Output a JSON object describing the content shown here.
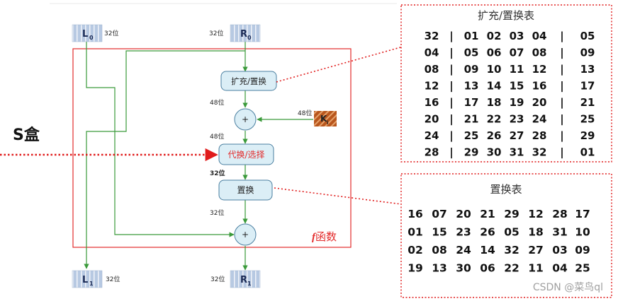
{
  "diagram": {
    "s_box_label": "S盒",
    "inputs": {
      "L0": {
        "main": "L",
        "sub": "0",
        "bits": "32位"
      },
      "R0": {
        "main": "R",
        "sub": "0",
        "bits": "32位"
      }
    },
    "outputs": {
      "L1": {
        "main": "L",
        "sub": "1",
        "bits": "32位"
      },
      "R1": {
        "main": "R",
        "sub": "1",
        "bits": "32位"
      }
    },
    "key": {
      "main": "K",
      "sub": "i",
      "bits": "48位"
    },
    "blocks": {
      "expand": "扩充/置换",
      "substitute": "代换/选择",
      "permute": "置换",
      "xor_symbol": "+"
    },
    "bit_labels": {
      "after_expand": "48位",
      "after_xor": "48位",
      "after_sbox": "32位",
      "after_perm": "32位"
    },
    "f_label": {
      "f": "f",
      "rest": "函数"
    }
  },
  "expansion_table": {
    "title": "扩充/置换表",
    "rows": [
      [
        "32",
        "|",
        "01",
        "02",
        "03",
        "04",
        "|",
        "05"
      ],
      [
        "04",
        "|",
        "05",
        "06",
        "07",
        "08",
        "|",
        "09"
      ],
      [
        "08",
        "|",
        "09",
        "10",
        "11",
        "12",
        "|",
        "13"
      ],
      [
        "12",
        "|",
        "13",
        "14",
        "15",
        "16",
        "|",
        "17"
      ],
      [
        "16",
        "|",
        "17",
        "18",
        "19",
        "20",
        "|",
        "21"
      ],
      [
        "20",
        "|",
        "21",
        "22",
        "23",
        "24",
        "|",
        "25"
      ],
      [
        "24",
        "|",
        "25",
        "26",
        "27",
        "28",
        "|",
        "29"
      ],
      [
        "28",
        "|",
        "29",
        "30",
        "31",
        "32",
        "|",
        "01"
      ]
    ]
  },
  "permutation_table": {
    "title": "置换表",
    "rows": [
      [
        "16",
        "07",
        "20",
        "21",
        "29",
        "12",
        "28",
        "17"
      ],
      [
        "01",
        "15",
        "23",
        "26",
        "05",
        "18",
        "31",
        "10"
      ],
      [
        "02",
        "08",
        "24",
        "14",
        "32",
        "27",
        "03",
        "09"
      ],
      [
        "19",
        "13",
        "30",
        "06",
        "22",
        "11",
        "04",
        "25"
      ]
    ]
  },
  "watermark": "CSDN @菜鸟ql",
  "colors": {
    "flow_green": "#3a9a3a",
    "frame_red": "#e32b2b",
    "dotted_red": "#e01b1b",
    "block_fill": "#dbeef6",
    "block_stroke": "#4a7fa0",
    "key_fill": "#b8561d",
    "io_fill": "#b7c9e2"
  }
}
